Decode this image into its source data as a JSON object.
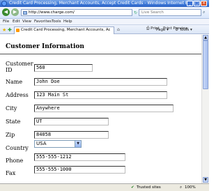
{
  "window": {
    "title": "Credit Card Processing, Merchant Accounts, Accept Credit Cards - Windows Internet Explorer"
  },
  "toolbar": {
    "address": "http://www.charge.com/",
    "search_placeholder": "Live Search"
  },
  "menu": [
    "File",
    "Edit",
    "View",
    "Favorites",
    "Tools",
    "Help"
  ],
  "tab": {
    "title": "Credit Card Processing, Merchant Accounts, Accept C..."
  },
  "commands": {
    "print": "Print",
    "print_preview": "Print Preview",
    "page": "Page",
    "tools": "Tools"
  },
  "form": {
    "heading": "Customer Information",
    "fields": [
      {
        "label": "Customer ID",
        "value": "560"
      },
      {
        "label": "Name",
        "value": "John Doe"
      },
      {
        "label": "Address",
        "value": "123 Main St"
      },
      {
        "label": "City",
        "value": "Anywhere"
      },
      {
        "label": "State",
        "value": "UT"
      },
      {
        "label": "Zip",
        "value": "84058"
      },
      {
        "label": "Country",
        "value": "USA"
      },
      {
        "label": "Phone",
        "value": "555-555-1212"
      },
      {
        "label": "Fax",
        "value": "555-555-1000"
      }
    ]
  },
  "status": {
    "zone": "Trusted sites",
    "zoom": "100%"
  },
  "colors": {
    "titlebar": "#3c78d8",
    "accent": "#d8542b"
  }
}
